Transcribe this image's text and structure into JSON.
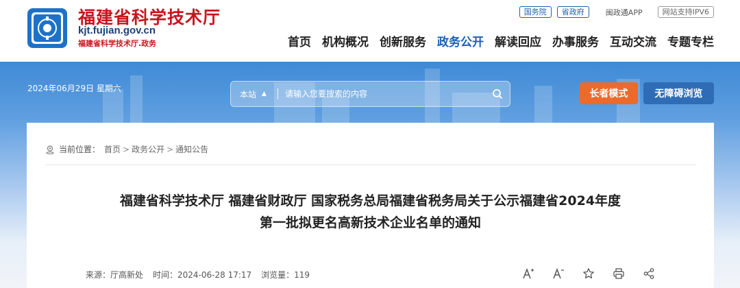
{
  "header": {
    "site_name": "福建省科学技术厅",
    "domain": "kjt.fujian.gov.cn",
    "subtitle": "福建省科学技术厅.政务",
    "top_links": {
      "state_council": "国务院",
      "province_gov": "省政府",
      "app": "闽政通APP",
      "ipv6": "网站支持IPV6"
    }
  },
  "nav": {
    "items": [
      {
        "label": "首页",
        "active": false
      },
      {
        "label": "机构概况",
        "active": false
      },
      {
        "label": "创新服务",
        "active": false
      },
      {
        "label": "政务公开",
        "active": true
      },
      {
        "label": "解读回应",
        "active": false
      },
      {
        "label": "办事服务",
        "active": false
      },
      {
        "label": "互动交流",
        "active": false
      },
      {
        "label": "专题专栏",
        "active": false
      }
    ]
  },
  "banner": {
    "date": "2024年06月29日 星期六",
    "search": {
      "scope": "本站",
      "placeholder": "请输入您要搜索的内容"
    },
    "elder_mode": "长者模式",
    "accessible": "无障碍浏览"
  },
  "breadcrumb": {
    "label": "当前位置：",
    "items": [
      "首页",
      "政务公开",
      "通知公告"
    ]
  },
  "article": {
    "title_line1": "福建省科学技术厅 福建省财政厅 国家税务总局福建省税务局关于公示福建省2024年度",
    "title_line2": "第一批拟更名高新技术企业名单的通知",
    "source": "来源：厅高新处",
    "time": "时间：2024-06-28 17:17",
    "views": "浏览量：119"
  },
  "colors": {
    "brand_red": "#c8151d",
    "nav_active": "#1a5fb4",
    "elder_btn": "#ec6a2b",
    "access_btn": "#2e6cb6"
  },
  "icons": [
    "emblem-icon",
    "location-icon",
    "search-icon",
    "font-increase-icon",
    "font-decrease-icon",
    "star-icon",
    "print-icon",
    "share-icon"
  ]
}
